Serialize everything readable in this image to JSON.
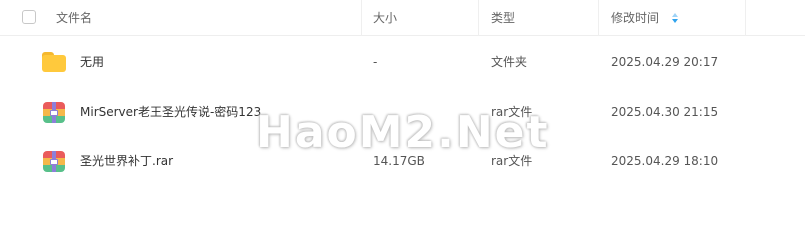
{
  "header": {
    "name": "文件名",
    "size": "大小",
    "type": "类型",
    "mtime": "修改时间"
  },
  "files": [
    {
      "name": "无用",
      "size": "-",
      "type": "文件夹",
      "mtime": "2025.04.29 20:17",
      "icon": "folder-icon"
    },
    {
      "name": "MirServer老王圣光传说-密码123",
      "size": "",
      "type": "rar文件",
      "mtime": "2025.04.30 21:15",
      "icon": "rar-archive-icon"
    },
    {
      "name": "圣光世界补丁.rar",
      "size": "14.17GB",
      "type": "rar文件",
      "mtime": "2025.04.29 18:10",
      "icon": "rar-archive-icon"
    }
  ],
  "watermark": "HaoM2.Net",
  "colors": {
    "folder": "#ffc93c",
    "sort_accent": "#2fa3ee",
    "border": "#eeeeee"
  }
}
